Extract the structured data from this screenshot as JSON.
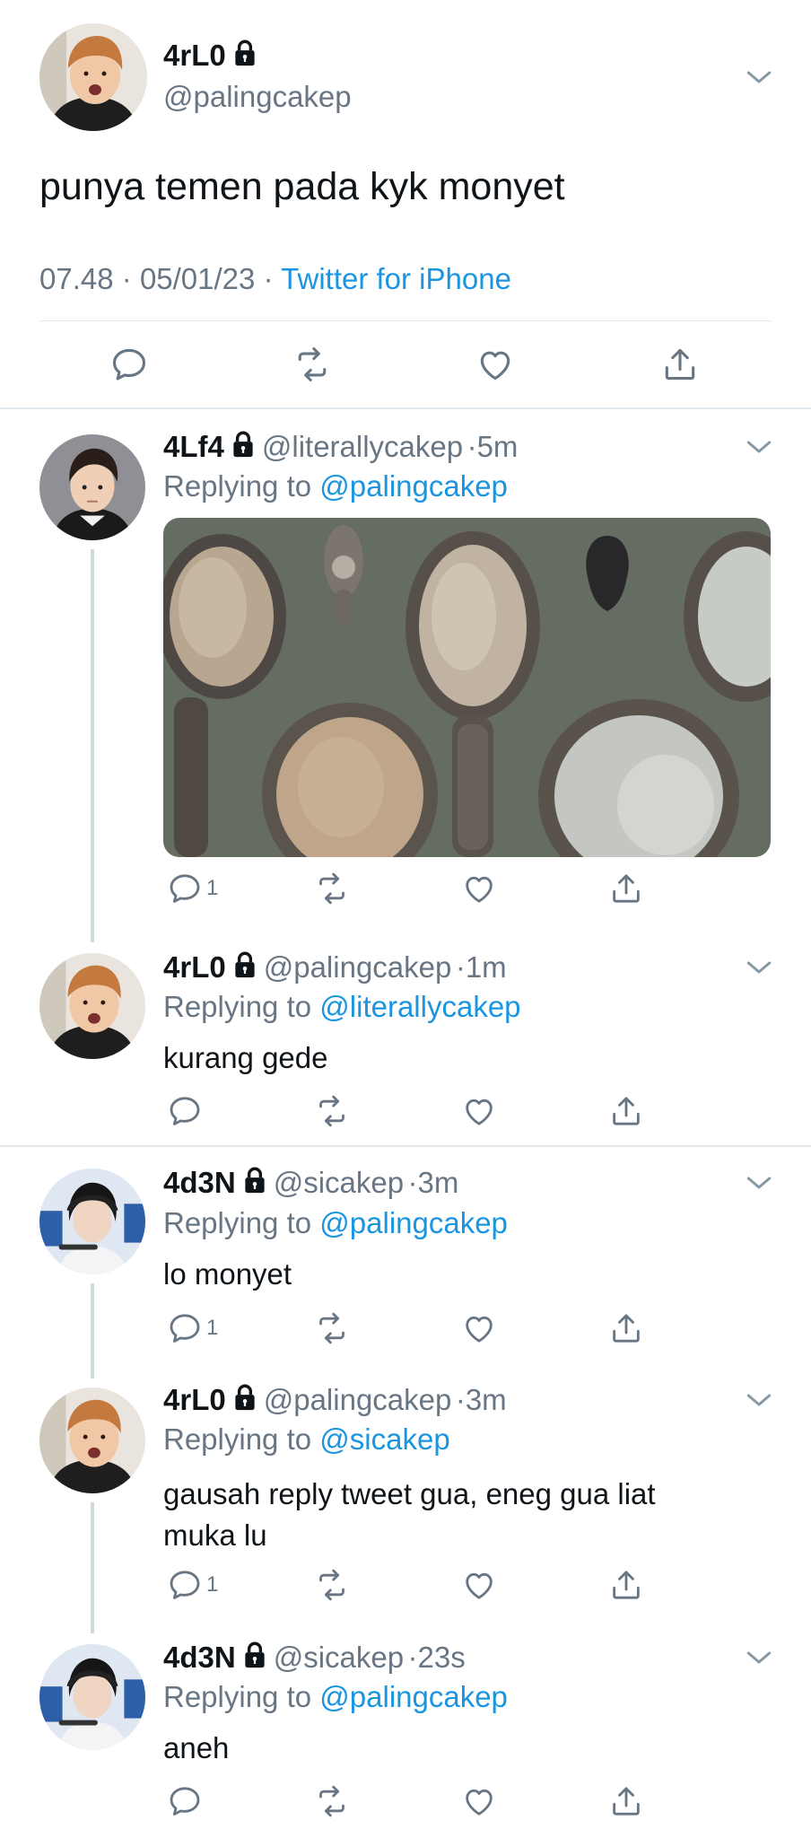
{
  "main_tweet": {
    "name": "4rL0",
    "handle": "@palingcakep",
    "text": "punya temen pada kyk monyet",
    "time": "07.48",
    "date": "05/01/23",
    "source": "Twitter for iPhone",
    "meta_sep1": "·",
    "meta_sep2": "·"
  },
  "replies": [
    {
      "name": "4Lf4",
      "handle": "@literallycakep",
      "time": "5m",
      "replying_prefix": "Replying to",
      "replying_to": "@palingcakep",
      "text": "",
      "reply_count": "1",
      "image_icon": "hand-mirrors-photo"
    },
    {
      "name": "4rL0",
      "handle": "@palingcakep",
      "time": "1m",
      "replying_prefix": "Replying to",
      "replying_to": "@literallycakep",
      "text": "kurang gede",
      "reply_count": ""
    },
    {
      "name": "4d3N",
      "handle": "@sicakep",
      "time": "3m",
      "replying_prefix": "Replying to",
      "replying_to": "@palingcakep",
      "text": "lo monyet",
      "reply_count": "1"
    },
    {
      "name": "4rL0",
      "handle": "@palingcakep",
      "time": "3m",
      "replying_prefix": "Replying to",
      "replying_to": "@sicakep",
      "text_line1": "gausah reply tweet gua, eneg gua liat",
      "text_line2": "muka lu",
      "reply_count": "1"
    },
    {
      "name": "4d3N",
      "handle": "@sicakep",
      "time": "23s",
      "replying_prefix": "Replying to",
      "replying_to": "@palingcakep",
      "text": "aneh",
      "reply_count": ""
    }
  ],
  "dot": "·",
  "colors": {
    "text": "#0f1419",
    "muted": "#687684",
    "link": "#1b95e0",
    "divider": "#e1e8ed",
    "thread_line": "#cfd9de"
  },
  "icons": [
    "reply-icon",
    "retweet-icon",
    "like-icon",
    "share-icon",
    "lock-icon",
    "chevron-down-icon"
  ]
}
